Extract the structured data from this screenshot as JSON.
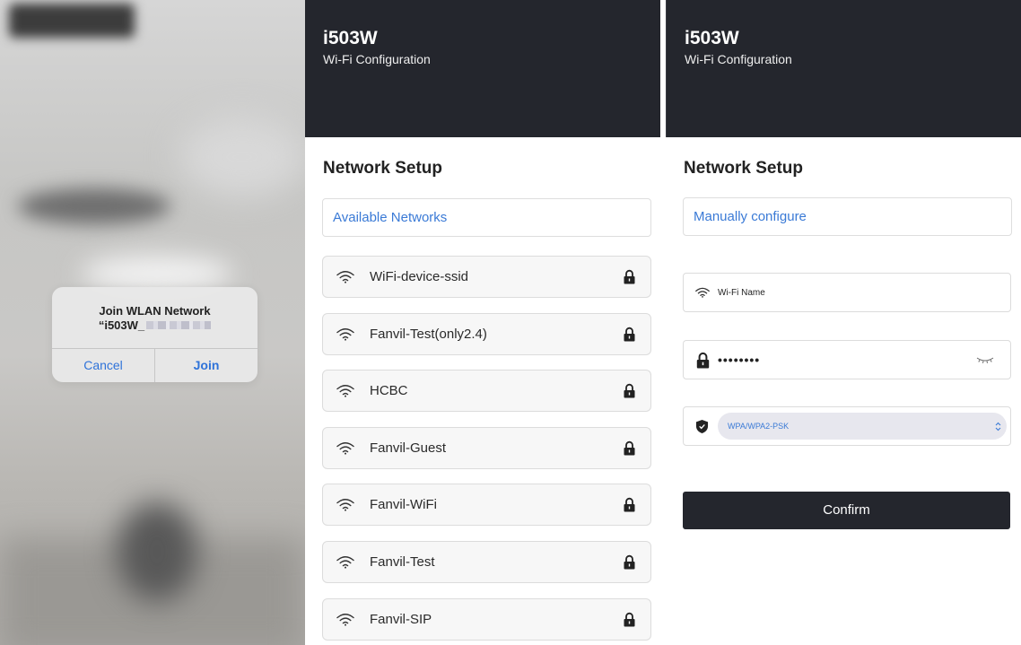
{
  "ios_dialog": {
    "title": "Join WLAN Network",
    "network_prefix": "“i503W_",
    "cancel_label": "Cancel",
    "join_label": "Join",
    "accent_color": "#2f73d9"
  },
  "app": {
    "device_name": "i503W",
    "subtitle": "Wi-Fi Configuration",
    "header_color": "#24262d",
    "accent_color": "#3a7ad6"
  },
  "scan_panel": {
    "section_title": "Network Setup",
    "tab_label": "Available Networks",
    "networks": [
      {
        "ssid": "WiFi-device-ssid",
        "icon": "wifi-icon",
        "secured_icon": "lock-icon"
      },
      {
        "ssid": "Fanvil-Test(only2.4)",
        "icon": "wifi-icon",
        "secured_icon": "lock-icon"
      },
      {
        "ssid": "HCBC",
        "icon": "wifi-icon",
        "secured_icon": "lock-icon"
      },
      {
        "ssid": "Fanvil-Guest",
        "icon": "wifi-icon",
        "secured_icon": "lock-icon"
      },
      {
        "ssid": "Fanvil-WiFi",
        "icon": "wifi-icon",
        "secured_icon": "lock-icon"
      },
      {
        "ssid": "Fanvil-Test",
        "icon": "wifi-icon",
        "secured_icon": "lock-icon"
      },
      {
        "ssid": "Fanvil-SIP",
        "icon": "wifi-icon",
        "secured_icon": "lock-icon"
      }
    ]
  },
  "manual_panel": {
    "section_title": "Network Setup",
    "tab_label": "Manually configure",
    "ssid_placeholder": "Wi-Fi Name",
    "password_mask": "••••••••",
    "security_value": "WPA/WPA2-PSK",
    "confirm_label": "Confirm"
  }
}
